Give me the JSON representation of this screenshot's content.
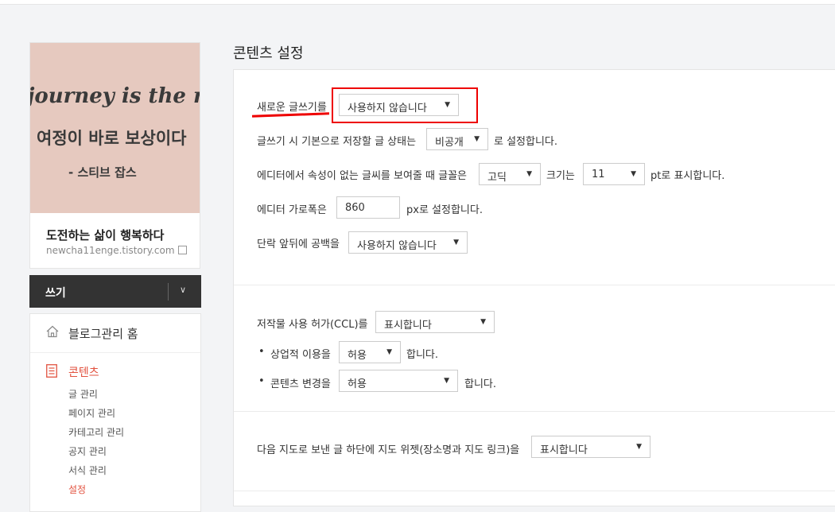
{
  "blog": {
    "cover_line1": "journey is the rew",
    "cover_line2": "여정이 바로 보상이다",
    "cover_line3": "- 스티브 잡스",
    "name": "도전하는 삶이 행복하다",
    "url": "newcha11enge.tistory.com"
  },
  "write_button": {
    "label": "쓰기"
  },
  "menu": {
    "home": "블로그관리 홈",
    "content_head": "콘텐츠",
    "items": [
      "글 관리",
      "페이지 관리",
      "카테고리 관리",
      "공지 관리",
      "서식 관리",
      "설정"
    ]
  },
  "page": {
    "title": "콘텐츠 설정"
  },
  "editor": {
    "new_editor_label": "새로운 글쓰기를",
    "new_editor_value": "사용하지 않습니다",
    "default_status_label": "글쓰기 시 기본으로 저장할 글 상태는",
    "default_status_value": "비공개",
    "default_status_suffix": "로 설정합니다.",
    "font_label": "에디터에서 속성이 없는 글씨를 보여줄 때 글꼴은",
    "font_value": "고딕",
    "size_label": "크기는",
    "size_value": "11",
    "size_suffix": "pt로 표시합니다.",
    "width_label": "에디터 가로폭은",
    "width_value": "860",
    "width_suffix": "px로 설정합니다.",
    "paragraph_label": "단락 앞뒤에 공백을",
    "paragraph_value": "사용하지 않습니다"
  },
  "ccl": {
    "label": "저작물 사용 허가(CCL)를",
    "value": "표시합니다",
    "bullet": "•",
    "commercial_label": "상업적 이용을",
    "commercial_value": "허용",
    "commercial_suffix": "합니다.",
    "modify_label": "콘텐츠 변경을",
    "modify_value": "허용",
    "modify_suffix": "합니다."
  },
  "map": {
    "label": "다음 지도로 보낸 글 하단에 지도 위젯(장소명과 지도 링크)을",
    "value": "표시합니다"
  },
  "colors": {
    "accent": "#e2523f",
    "highlight": "#ee0000",
    "dark_bar": "#333333"
  }
}
